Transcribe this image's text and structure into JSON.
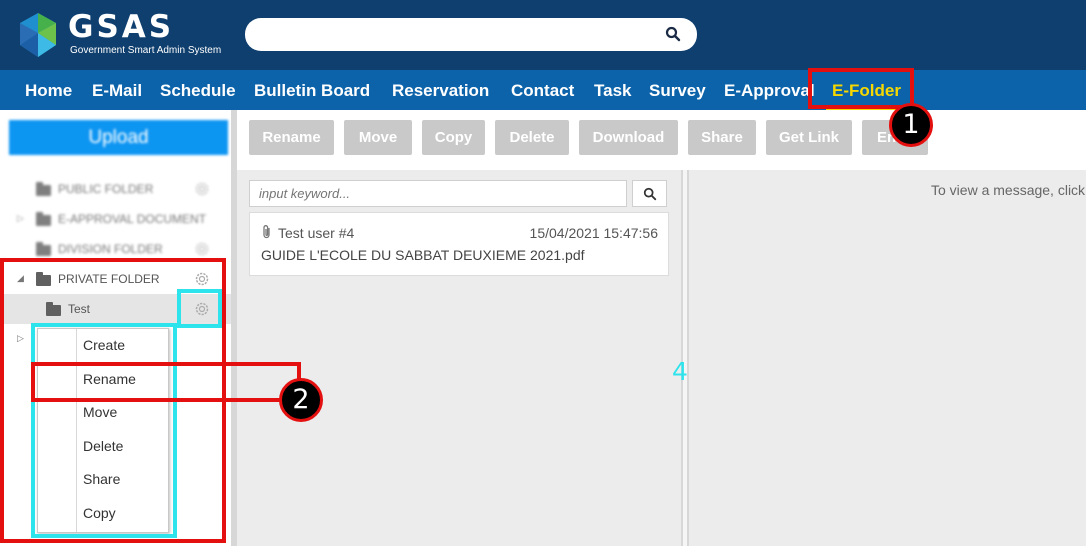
{
  "header": {
    "logo_text": "GSAS",
    "logo_subtitle": "Government Smart Admin System",
    "search_placeholder": ""
  },
  "nav": {
    "items": [
      {
        "label": "Home"
      },
      {
        "label": "E-Mail"
      },
      {
        "label": "Schedule"
      },
      {
        "label": "Bulletin Board"
      },
      {
        "label": "Reservation"
      },
      {
        "label": "Contact"
      },
      {
        "label": "Task"
      },
      {
        "label": "Survey"
      },
      {
        "label": "E-Approval"
      },
      {
        "label": "E-Folder",
        "active": true
      }
    ],
    "active_color": "#f6d800"
  },
  "sidebar": {
    "upload_label": "Upload",
    "folders": [
      {
        "label": "PUBLIC FOLDER"
      },
      {
        "label": "E-APPROVAL DOCUMENT"
      },
      {
        "label": "DIVISION FOLDER"
      },
      {
        "label": "PRIVATE FOLDER"
      },
      {
        "label": "Test"
      }
    ],
    "context_menu": [
      "Create",
      "Rename",
      "Move",
      "Delete",
      "Share",
      "Copy"
    ]
  },
  "toolbar": {
    "buttons": [
      "Rename",
      "Move",
      "Copy",
      "Delete",
      "Download",
      "Share",
      "Get Link",
      "En"
    ]
  },
  "list": {
    "keyword_placeholder": "input keyword...",
    "messages": [
      {
        "sender": "Test user #4",
        "date": "15/04/2021 15:47:56",
        "subject": "GUIDE L'ECOLE DU SABBAT DEUXIEME 2021.pdf"
      }
    ]
  },
  "viewer": {
    "hint": "To view a message, click"
  },
  "annotations": {
    "callouts": [
      "1",
      "2",
      "4"
    ],
    "red": "#e41010",
    "cyan": "#2de3ec"
  }
}
